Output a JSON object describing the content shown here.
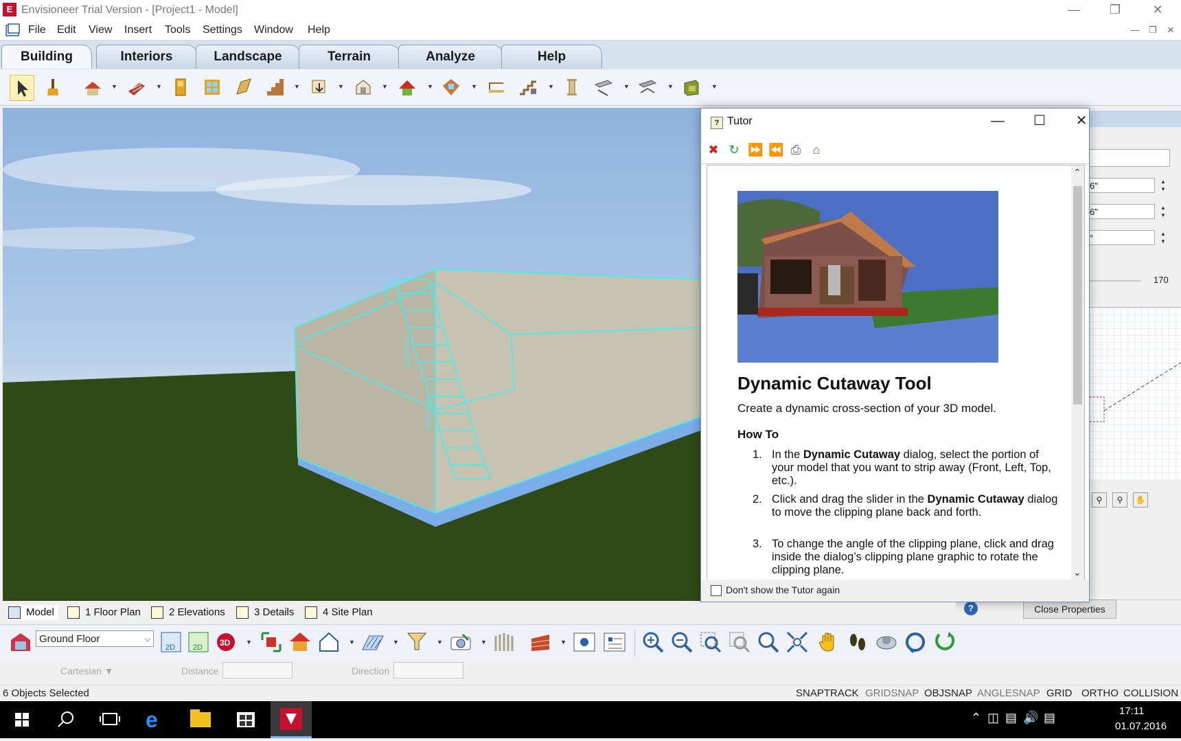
{
  "window": {
    "title": "Envisioneer Trial Version - [Project1 - Model]",
    "minimize": "—",
    "restore": "❐",
    "close": "✕"
  },
  "menu": [
    "File",
    "Edit",
    "View",
    "Insert",
    "Tools",
    "Settings",
    "Window",
    "Help"
  ],
  "ribbon_tabs": [
    {
      "label": "Building",
      "active": true
    },
    {
      "label": "Interiors",
      "active": false
    },
    {
      "label": "Landscape",
      "active": false
    },
    {
      "label": "Terrain",
      "active": false
    },
    {
      "label": "Analyze",
      "active": false
    },
    {
      "label": "Help",
      "active": false
    }
  ],
  "toolbar_icons": [
    "select-arrow-icon",
    "paintbrush-icon",
    "roof-wand-icon",
    "wall-icon",
    "door-icon",
    "window-icon",
    "opening-icon",
    "stair-icon",
    "ramp-icon",
    "room-icon",
    "roof-icon",
    "skylight-icon",
    "deck-icon",
    "railing-icon",
    "column-icon",
    "beam-icon",
    "truss-icon",
    "cabinet-icon"
  ],
  "tutor": {
    "title": "Tutor",
    "heading": "Dynamic Cutaway Tool",
    "intro": "Create a dynamic cross-section of your 3D model.",
    "howto": "How To",
    "steps": [
      {
        "num": "1.",
        "html": "In the <b>Dynamic Cutaway</b> dialog, select the portion of your model that you want to strip away (Front, Left, Top, etc.)."
      },
      {
        "num": "2.",
        "html": "Click and drag the slider in the <b>Dynamic Cutaway</b> dialog to move the clipping plane back and forth."
      },
      {
        "num": "3.",
        "html": "To change the angle of the clipping plane, click and drag inside the dialog’s clipping plane graphic to rotate the clipping plane."
      }
    ],
    "dont_show": "Don't show the Tutor again"
  },
  "properties": {
    "field1": "6\"",
    "field2": "6\"",
    "field3": "°",
    "slider_value": "170",
    "close_button": "Close Properties",
    "help": "?"
  },
  "view_tabs": [
    "Model",
    "1 Floor Plan",
    "2 Elevations",
    "3 Details",
    "4 Site Plan"
  ],
  "floor_select": "Ground Floor",
  "coords": {
    "mode": "Cartesian",
    "distance": "Distance",
    "direction": "Direction"
  },
  "status": {
    "selected": "6 Objects Selected",
    "flags": [
      {
        "label": "SNAPTRACK",
        "on": true
      },
      {
        "label": "GRIDSNAP",
        "on": false
      },
      {
        "label": "OBJSNAP",
        "on": true
      },
      {
        "label": "ANGLESNAP",
        "on": false
      },
      {
        "label": "GRID",
        "on": true
      },
      {
        "label": "ORTHO",
        "on": true
      },
      {
        "label": "COLLISION",
        "on": true
      }
    ]
  },
  "taskbar": {
    "time": "17:11",
    "date": "01.07.2016"
  },
  "colors": {
    "accent": "#c8102e",
    "selection": "#3ff0f0",
    "sky": "#8fb3de",
    "grass": "#2f4a17"
  }
}
